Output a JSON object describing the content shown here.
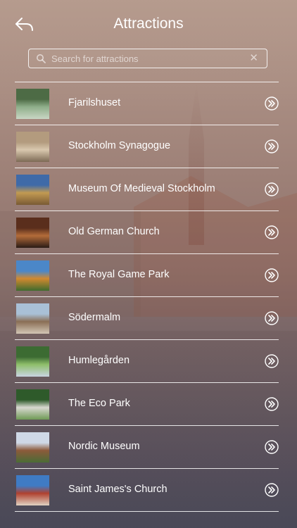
{
  "header": {
    "title": "Attractions"
  },
  "search": {
    "placeholder": "Search for attractions",
    "value": ""
  },
  "attractions": [
    {
      "name": "Fjarilshuset",
      "thumb_colors": [
        "#4d6b45",
        "#8fae8a",
        "#c9d6c4"
      ]
    },
    {
      "name": "Stockholm Synagogue",
      "thumb_colors": [
        "#b39b7e",
        "#d9c8ae",
        "#7d6a55"
      ]
    },
    {
      "name": "Museum Of Medieval Stockholm",
      "thumb_colors": [
        "#3f6aa8",
        "#c29a52",
        "#7a5a34"
      ]
    },
    {
      "name": "Old German Church",
      "thumb_colors": [
        "#5a2e1c",
        "#b36c3a",
        "#2a1b16"
      ]
    },
    {
      "name": "The Royal Game Park",
      "thumb_colors": [
        "#4b87c8",
        "#d1892f",
        "#3f6b2e"
      ]
    },
    {
      "name": "Södermalm",
      "thumb_colors": [
        "#a9c0d6",
        "#8a6e55",
        "#d2c6b5"
      ]
    },
    {
      "name": "Humlegården",
      "thumb_colors": [
        "#3c6b32",
        "#8fbf6a",
        "#c9d4e2"
      ]
    },
    {
      "name": "The Eco Park",
      "thumb_colors": [
        "#2e5a2a",
        "#d8d8d0",
        "#6f9a55"
      ]
    },
    {
      "name": "Nordic Museum",
      "thumb_colors": [
        "#cfd8e6",
        "#8c5a3a",
        "#4a6b36"
      ]
    },
    {
      "name": "Saint James's Church",
      "thumb_colors": [
        "#3f7bc4",
        "#b0412f",
        "#e0d2c2"
      ]
    }
  ],
  "icons": {
    "back": "back-arrow-icon",
    "search": "search-icon",
    "clear": "clear-icon",
    "row_action": "double-chevron-right-icon"
  }
}
